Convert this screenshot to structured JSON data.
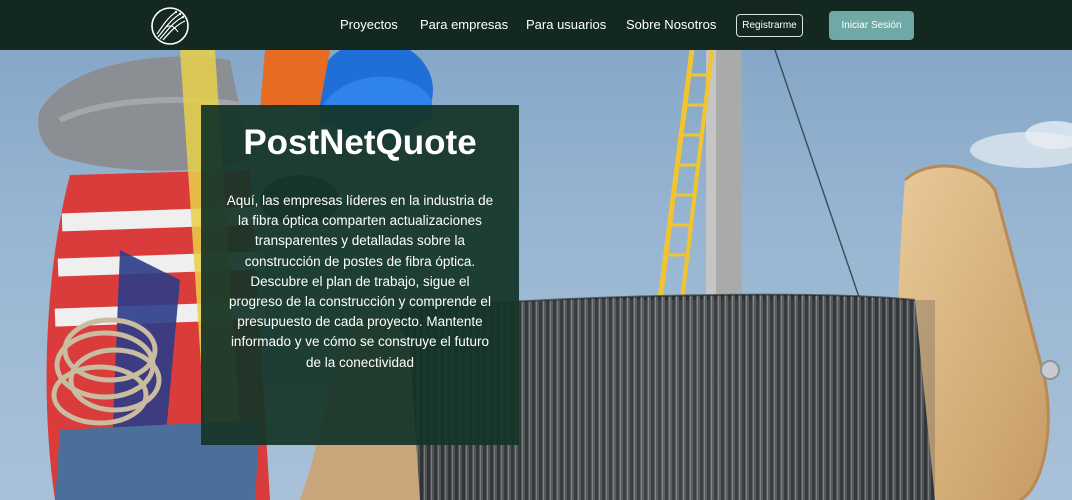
{
  "nav": {
    "links": [
      {
        "label": "Proyectos"
      },
      {
        "label": "Para empresas"
      },
      {
        "label": "Para usuarios"
      },
      {
        "label": "Sobre Nosotros"
      }
    ],
    "register_label": "Registrarme",
    "login_label": "Iniciar Sesión"
  },
  "hero": {
    "title": "PostNetQuote",
    "description": "Aquí, las empresas líderes en la industria de la fibra óptica comparten actualizaciones transparentes y detalladas sobre la construcción de postes de fibra óptica. Descubre el plan de trabajo, sigue el progreso de la construcción y comprende el presupuesto de cada proyecto. Mantente informado y ve cómo se construye el futuro de la conectividad"
  },
  "colors": {
    "navbar": "#13281f",
    "card": "#143428",
    "login_button": "#6fa8a4"
  }
}
